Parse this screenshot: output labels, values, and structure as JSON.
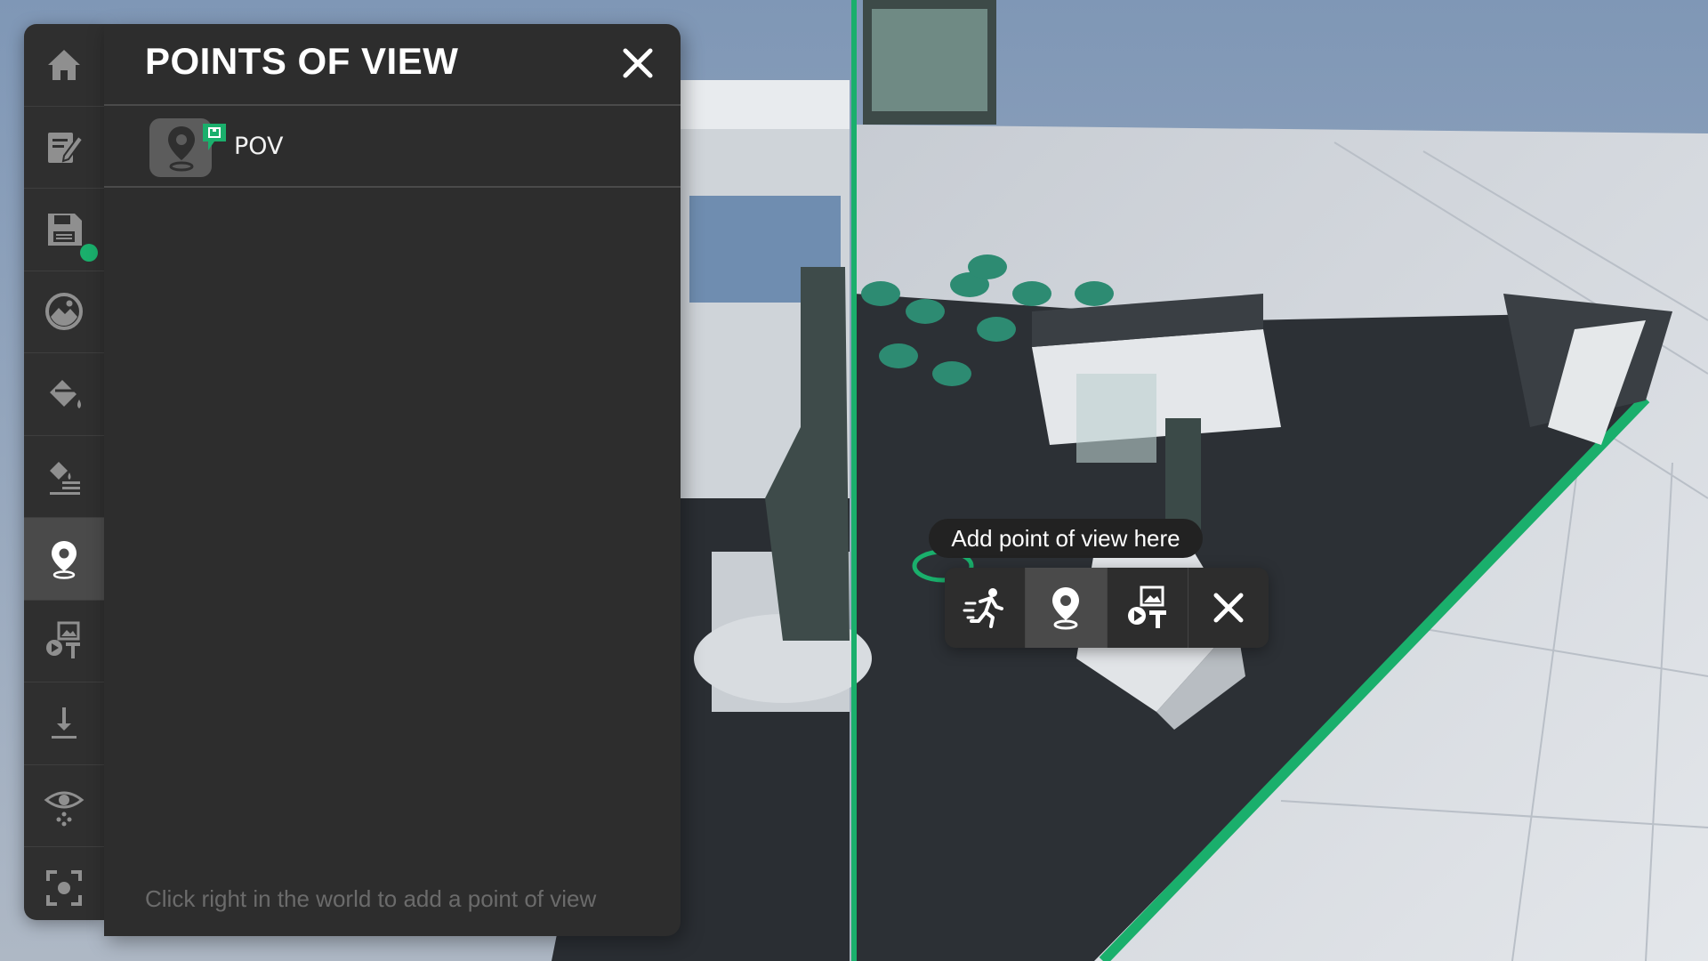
{
  "toolbar": {
    "items": [
      {
        "icon": "home-icon",
        "active": false
      },
      {
        "icon": "edit-icon",
        "active": false
      },
      {
        "icon": "save-icon",
        "active": false,
        "status_dot": true
      },
      {
        "icon": "environment-icon",
        "active": false
      },
      {
        "icon": "paint-bucket-icon",
        "active": false
      },
      {
        "icon": "material-layers-icon",
        "active": false
      },
      {
        "icon": "location-pin-icon",
        "active": true
      },
      {
        "icon": "media-text-icon",
        "active": false
      },
      {
        "icon": "download-icon",
        "active": false
      },
      {
        "icon": "visibility-icon",
        "active": false
      },
      {
        "icon": "focus-icon",
        "active": false
      }
    ]
  },
  "panel": {
    "title": "POINTS OF VIEW",
    "items": [
      {
        "label": "POV"
      }
    ],
    "hint": "Click right in the world to add a point of view"
  },
  "popup": {
    "tooltip": "Add point of view here",
    "actions": [
      "walk-here-icon",
      "location-pin-icon",
      "media-text-icon",
      "close-icon"
    ],
    "active_action": "location-pin-icon"
  },
  "colors": {
    "accent": "#1aaf6c",
    "panel_bg": "#2d2d2d",
    "toolbar_bg": "#2f2f2f",
    "active_bg": "#4a4a4a"
  }
}
